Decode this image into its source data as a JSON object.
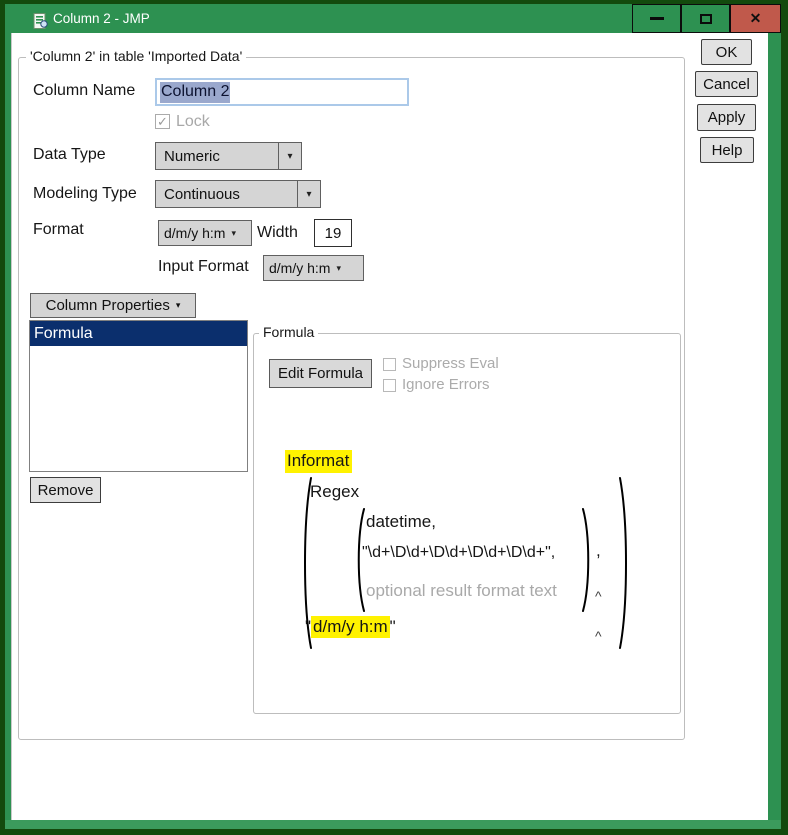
{
  "window": {
    "title": "Column 2 - JMP",
    "close_glyph": "✕"
  },
  "actions": {
    "ok": "OK",
    "cancel": "Cancel",
    "apply": "Apply",
    "help": "Help"
  },
  "ui": {
    "dropdown_arrow": "▾",
    "check_glyph": "✓",
    "caret": "^",
    "comma": ","
  },
  "main_group": {
    "title": "'Column 2' in table 'Imported Data'",
    "column_name_label": "Column Name",
    "column_name_value": "Column 2",
    "lock_label": "Lock",
    "lock_checked": true,
    "data_type_label": "Data Type",
    "data_type_value": "Numeric",
    "modeling_type_label": "Modeling Type",
    "modeling_type_value": "Continuous",
    "format_label": "Format",
    "format_value": "d/m/y h:m",
    "width_label": "Width",
    "width_value": "19",
    "input_format_label": "Input Format",
    "input_format_value": "d/m/y h:m",
    "column_properties_label": "Column Properties",
    "properties_list": [
      {
        "label": "Formula",
        "selected": true
      }
    ],
    "remove_label": "Remove"
  },
  "formula_group": {
    "title": "Formula",
    "edit_formula_label": "Edit Formula",
    "suppress_eval_label": "Suppress Eval",
    "ignore_errors_label": "Ignore Errors",
    "formula": {
      "outer_function": "Informat",
      "inner_function": "Regex",
      "arg_datetime": "datetime,",
      "arg_pattern": "\"\\d+\\D\\d+\\D\\d+\\D\\d+\\D\\d+\",",
      "arg_optional": "optional result format text",
      "quote": "\"",
      "result_format": "d/m/y h:m"
    }
  },
  "colors": {
    "titlebar_green": "#2d9151",
    "border_green": "#134a0d",
    "close_red": "#c0594b",
    "selection_navy": "#0b2f6d",
    "text_selection_blue": "#9aa8cd",
    "highlight_yellow": "#fff200"
  }
}
